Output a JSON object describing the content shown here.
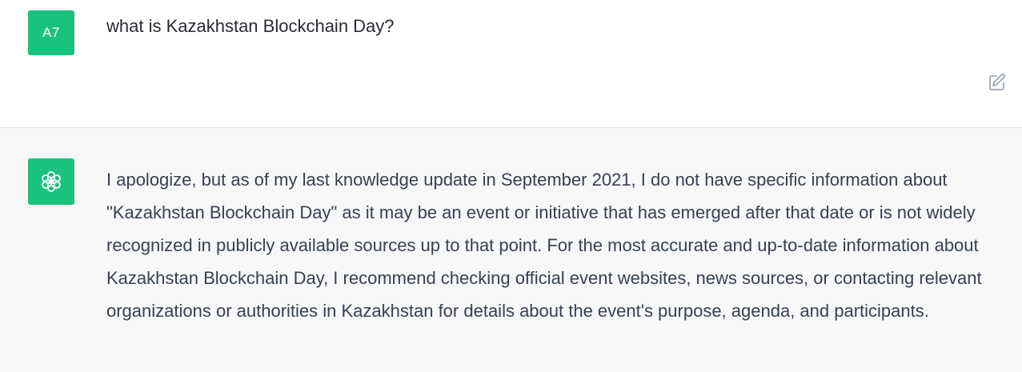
{
  "user_message": {
    "avatar_initials": "A7",
    "avatar_color": "#19c37d",
    "text": "what is Kazakhstan Blockchain Day?"
  },
  "edit_button": {
    "icon": "edit-icon"
  },
  "assistant_message": {
    "avatar_icon": "openai-logo-icon",
    "avatar_color": "#19c37d",
    "text": "I apologize, but as of my last knowledge update in September 2021, I do not have specific information about \"Kazakhstan Blockchain Day\" as it may be an event or initiative that has emerged after that date or is not widely recognized in publicly available sources up to that point. For the most accurate and up-to-date information about Kazakhstan Blockchain Day, I recommend checking official event websites, news sources, or contacting relevant organizations or authorities in Kazakhstan for details about the event's purpose, agenda, and participants."
  }
}
